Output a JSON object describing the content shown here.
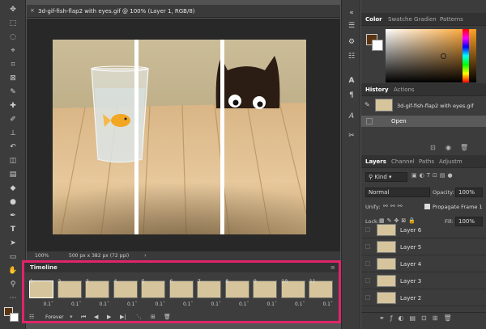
{
  "document": {
    "tab_title": "3d-gif-fish-flap2 with eyes.gif @ 100% (Layer 1, RGB/8)",
    "close_glyph": "×",
    "zoom": "100%",
    "doc_info": "500 px x 382 px (72 ppi)"
  },
  "timeline": {
    "title": "Timeline",
    "loop": "Forever",
    "frames": [
      {
        "num": "1",
        "dur": "0.1ˇ",
        "selected": true
      },
      {
        "num": "2",
        "dur": "0.1ˇ"
      },
      {
        "num": "3",
        "dur": "0.1ˇ"
      },
      {
        "num": "4",
        "dur": "0.1ˇ"
      },
      {
        "num": "5",
        "dur": "0.1ˇ"
      },
      {
        "num": "6",
        "dur": "0.1ˇ"
      },
      {
        "num": "7",
        "dur": "0.1ˇ"
      },
      {
        "num": "8",
        "dur": "0.1ˇ"
      },
      {
        "num": "9",
        "dur": "0.1ˇ"
      },
      {
        "num": "10",
        "dur": "0.1ˇ"
      },
      {
        "num": "11",
        "dur": "0.1ˇ"
      }
    ]
  },
  "color_panel": {
    "tabs": [
      "Color",
      "Swatche",
      "Gradien",
      "Patterns"
    ],
    "foreground": "#5a3410",
    "background": "#ffffff"
  },
  "history_panel": {
    "tabs": [
      "History",
      "Actions"
    ],
    "snapshot": "3d-gif-fish-flap2 with eyes.gif",
    "state": "Open"
  },
  "layers_panel": {
    "tabs": [
      "Layers",
      "Channel",
      "Paths",
      "Adjustm"
    ],
    "filter": "Kind",
    "blend_mode": "Normal",
    "opacity_label": "Opacity:",
    "opacity": "100%",
    "unify_label": "Unify:",
    "propagate": "Propagate Frame 1",
    "lock_label": "Lock:",
    "fill_label": "Fill:",
    "fill": "100%",
    "layers": [
      "Layer 6",
      "Layer 5",
      "Layer 4",
      "Layer 3",
      "Layer 2"
    ]
  },
  "colors": {
    "accent_highlight": "#e0246a"
  }
}
